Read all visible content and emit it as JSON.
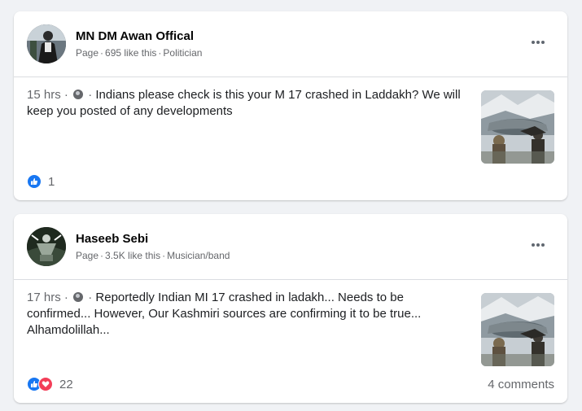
{
  "posts": [
    {
      "author": "MN DM Awan Offical",
      "meta_page": "Page",
      "meta_likes": "695 like this",
      "meta_category": "Politician",
      "time": "15 hrs",
      "text": "Indians please check is this your M 17 crashed in Laddakh? We will keep you posted of any developments",
      "reaction_count": "1",
      "comments": ""
    },
    {
      "author": "Haseeb Sebi",
      "meta_page": "Page",
      "meta_likes": "3.5K like this",
      "meta_category": "Musician/band",
      "time": "17 hrs",
      "text": "Reportedly Indian MI 17 crashed in ladakh... Needs to be confirmed... However, Our Kashmiri sources are confirming it to be true... Alhamdolillah...",
      "reaction_count": "22",
      "comments": "4 comments"
    }
  ],
  "colors": {
    "like": "#1877f2",
    "love": "#f33e58",
    "secondary_text": "#65676b",
    "background": "#f0f2f5"
  },
  "icons": {
    "more": "more-options-icon",
    "audience": "globe-icon",
    "like": "like-reaction-icon",
    "love": "love-reaction-icon"
  }
}
